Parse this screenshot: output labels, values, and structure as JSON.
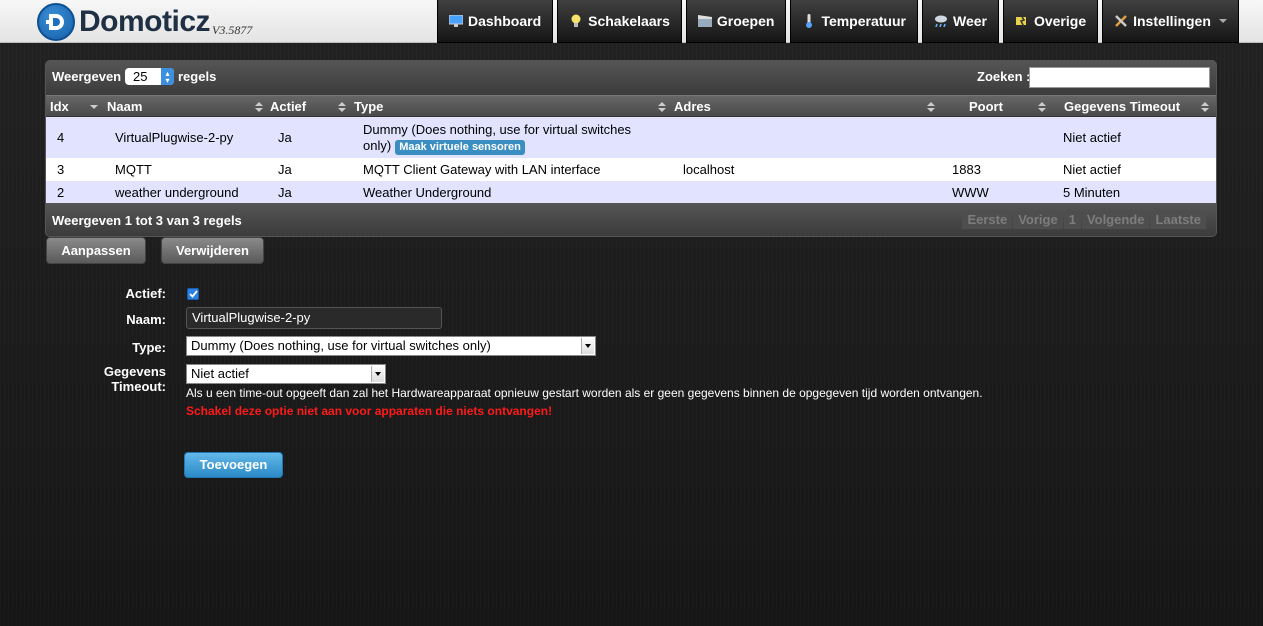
{
  "app": {
    "title": "Domoticz",
    "version": "V3.5877"
  },
  "nav": [
    {
      "label": "Dashboard",
      "icon": "monitor-icon"
    },
    {
      "label": "Schakelaars",
      "icon": "lightbulb-icon"
    },
    {
      "label": "Groepen",
      "icon": "clapperboard-icon"
    },
    {
      "label": "Temperatuur",
      "icon": "thermometer-icon"
    },
    {
      "label": "Weer",
      "icon": "rain-cloud-icon"
    },
    {
      "label": "Overige",
      "icon": "plug-icon"
    },
    {
      "label": "Instellingen",
      "icon": "tools-icon"
    }
  ],
  "table": {
    "length_label_pre": "Weergeven",
    "length_value": "25",
    "length_label_post": "regels",
    "search_label": "Zoeken :",
    "search_value": "",
    "columns": [
      "Idx",
      "Naam",
      "Actief",
      "Type",
      "Adres",
      "Poort",
      "Gegevens Timeout"
    ],
    "rows": [
      {
        "idx": "4",
        "name": "VirtualPlugwise-2-py",
        "active": "Ja",
        "type": "Dummy (Does nothing, use for virtual switches only)",
        "type_badge": "Maak virtuele sensoren",
        "address": "",
        "port": "",
        "timeout": "Niet actief"
      },
      {
        "idx": "3",
        "name": "MQTT",
        "active": "Ja",
        "type": "MQTT Client Gateway with LAN interface",
        "type_badge": "",
        "address": "localhost",
        "port": "1883",
        "timeout": "Niet actief"
      },
      {
        "idx": "2",
        "name": "weather underground",
        "active": "Ja",
        "type": "Weather Underground",
        "type_badge": "",
        "address": "",
        "port": "WWW",
        "timeout": "5 Minuten"
      }
    ],
    "info": "Weergeven 1 tot 3 van 3 regels",
    "paging": [
      "Eerste",
      "Vorige",
      "1",
      "Volgende",
      "Laatste"
    ]
  },
  "actions": {
    "update_label": "Aanpassen",
    "delete_label": "Verwijderen"
  },
  "form": {
    "active_label": "Actief:",
    "active_checked": true,
    "name_label": "Naam:",
    "name_value": "VirtualPlugwise-2-py",
    "type_label": "Type:",
    "type_value": "Dummy (Does nothing, use for virtual switches only)",
    "timeout_label_line1": "Gegevens",
    "timeout_label_line2": "Timeout:",
    "timeout_value": "Niet actief",
    "timeout_help": "Als u een time-out opgeeft dan zal het Hardwareapparaat opnieuw gestart worden als er geen gegevens binnen de opgegeven tijd worden ontvangen.",
    "timeout_warning": "Schakel deze optie niet aan voor apparaten die niets ontvangen!",
    "add_label": "Toevoegen"
  },
  "colors": {
    "accent": "#3b8ec1",
    "warning": "#ff1a1a",
    "row_highlight": "#e2e4ff"
  }
}
